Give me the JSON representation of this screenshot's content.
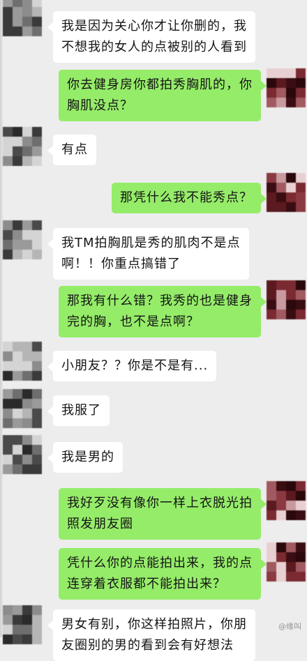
{
  "chat": {
    "messages": [
      {
        "side": "left",
        "lines": [
          "我是因为关心你才让你删的，我",
          "不想我的女人的点被别的人看到"
        ]
      },
      {
        "side": "right",
        "lines": [
          "你去健身房你都拍秀胸肌的，你",
          "胸肌没点？"
        ]
      },
      {
        "side": "left",
        "lines": [
          "有点"
        ]
      },
      {
        "side": "right",
        "lines": [
          "那凭什么我不能秀点？"
        ]
      },
      {
        "side": "left",
        "lines": [
          "我TM拍胸肌是秀的肌肉不是点",
          "啊！！你重点搞错了"
        ]
      },
      {
        "side": "right",
        "lines": [
          "那我有什么错？我秀的也是健身",
          "完的胸，也不是点啊？"
        ]
      },
      {
        "side": "left",
        "lines": [
          "小朋友？？你是不是有..."
        ]
      },
      {
        "side": "left",
        "lines": [
          "我服了"
        ]
      },
      {
        "side": "left",
        "lines": [
          "我是男的"
        ]
      },
      {
        "side": "right",
        "lines": [
          "我好歹没有像你一样上衣脱光拍",
          "照发朋友圈"
        ]
      },
      {
        "side": "right",
        "lines": [
          "凭什么你的点能拍出来，我的点",
          "连穿着衣服都不能拍出来？"
        ]
      },
      {
        "side": "left",
        "lines": [
          "男女有别，你这样拍照片，你朋",
          "友圈别的男的看到会有好想法"
        ]
      }
    ]
  },
  "colors": {
    "background": "#ededed",
    "bubble_left": "#ffffff",
    "bubble_right": "#95ec69"
  },
  "watermark": "@缘叫"
}
